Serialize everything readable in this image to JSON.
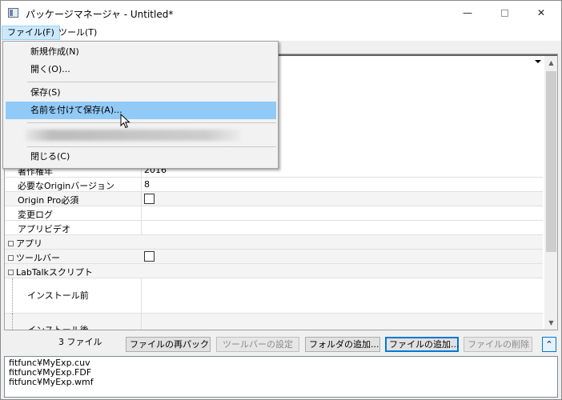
{
  "window": {
    "title": "パッケージマネージャ - Untitled*",
    "minimize_glyph": "—",
    "close_glyph": "✕"
  },
  "menubar": {
    "file": "ファイル(F)",
    "tool": "ツール(T)"
  },
  "file_menu": {
    "items": [
      {
        "label": "新規作成(N)"
      },
      {
        "label": "開く(O)..."
      },
      {
        "label": "保存(S)"
      },
      {
        "label": "名前を付けて保存(A)..."
      },
      {
        "label": "閉じる(C)"
      }
    ]
  },
  "grid": {
    "rows": [
      {
        "key": "著作権年",
        "value": "2016"
      },
      {
        "key": "必要なOriginバージョン",
        "value": "8"
      },
      {
        "key": "Origin Pro必須",
        "value": ""
      },
      {
        "key": "変更ログ",
        "value": ""
      },
      {
        "key": "アプリビデオ",
        "value": ""
      },
      {
        "key": "アプリ",
        "value": ""
      },
      {
        "key": "ツールバー",
        "value": ""
      },
      {
        "key": "LabTalkスクリプト",
        "value": ""
      },
      {
        "key": "インストール前",
        "value": ""
      },
      {
        "key": "インストール後",
        "value": ""
      }
    ]
  },
  "toolbar": {
    "file_count": "3 ファイル",
    "repack": "ファイルの再パック",
    "toolbar_settings": "ツールバーの設定",
    "add_folder": "フォルダの追加...",
    "add_file": "ファイルの追加...",
    "delete_file": "ファイルの削除",
    "collapse_glyph": "⌃"
  },
  "files": [
    "fitfunc¥MyExp.cuv",
    "fitfunc¥MyExp.FDF",
    "fitfunc¥MyExp.wmf"
  ],
  "colors": {
    "menu_highlight": "#91c9f7",
    "focus_border": "#0078d7"
  }
}
